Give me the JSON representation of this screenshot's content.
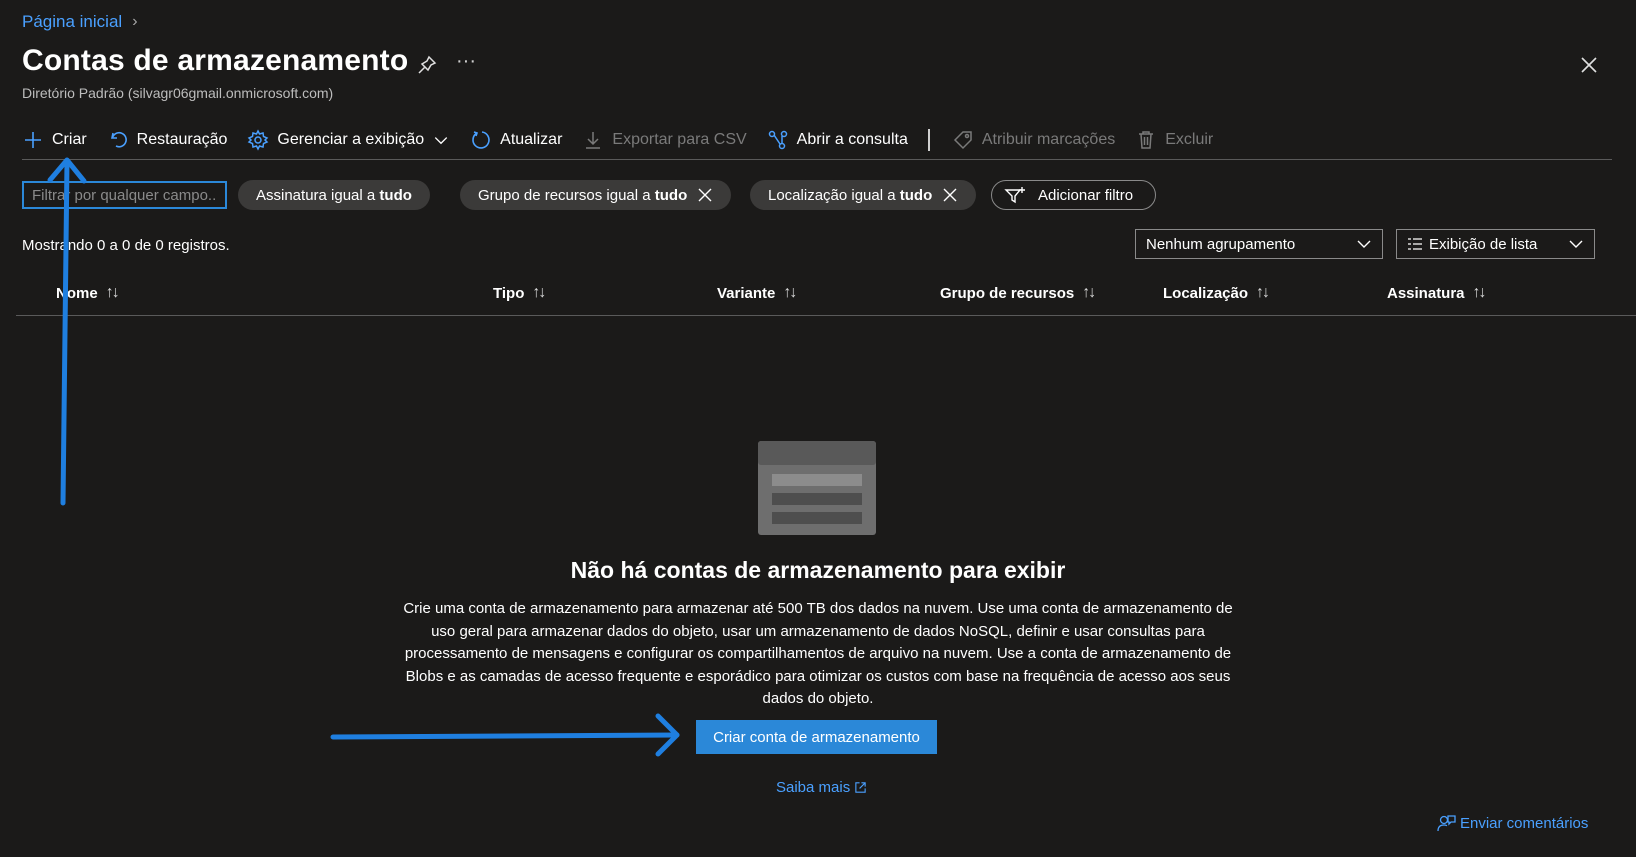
{
  "breadcrumb": {
    "home": "Página inicial",
    "separator": "›"
  },
  "header": {
    "title": "Contas de armazenamento",
    "more": "···",
    "subtitle": "Diretório Padrão (silvagr06gmail.onmicrosoft.com)"
  },
  "toolbar": {
    "create": "Criar",
    "restore": "Restauração",
    "manage_view": "Gerenciar a exibição",
    "refresh": "Atualizar",
    "export_csv": "Exportar para CSV",
    "open_query": "Abrir a consulta",
    "assign_tags": "Atribuir marcações",
    "delete": "Excluir"
  },
  "filters": {
    "search_placeholder": "Filtrar por qualquer campo...",
    "subscription": {
      "label": "Assinatura igual a ",
      "value": "tudo"
    },
    "resource_group": {
      "label": "Grupo de recursos igual a ",
      "value": "tudo"
    },
    "location": {
      "label": "Localização igual a ",
      "value": "tudo"
    },
    "add_filter": "Adicionar filtro"
  },
  "list": {
    "showing": "Mostrando 0 a 0 de 0 registros.",
    "grouping": "Nenhum agrupamento",
    "view_mode": "Exibição de lista"
  },
  "table": {
    "sort_glyph": "↑↓",
    "columns": [
      "Nome",
      "Tipo",
      "Variante",
      "Grupo de recursos",
      "Localização",
      "Assinatura"
    ]
  },
  "empty_state": {
    "title": "Não há contas de armazenamento para exibir",
    "description": "Crie uma conta de armazenamento para armazenar até 500 TB dos dados na nuvem. Use uma conta de armazenamento de uso geral para armazenar dados do objeto, usar um armazenamento de dados NoSQL, definir e usar consultas para processamento de mensagens e configurar os compartilhamentos de arquivo na nuvem. Use a conta de armazenamento de Blobs e as camadas de acesso frequente e esporádico para otimizar os custos com base na frequência de acesso aos seus dados do objeto.",
    "cta": "Criar conta de armazenamento",
    "learn_more": "Saiba mais"
  },
  "footer": {
    "feedback": "Enviar comentários"
  },
  "colors": {
    "background": "#1b1a19",
    "accent": "#2b88d8",
    "link": "#4aa0ff",
    "annotation_arrow": "#1f7fe0",
    "pill": "#3b3a39"
  }
}
